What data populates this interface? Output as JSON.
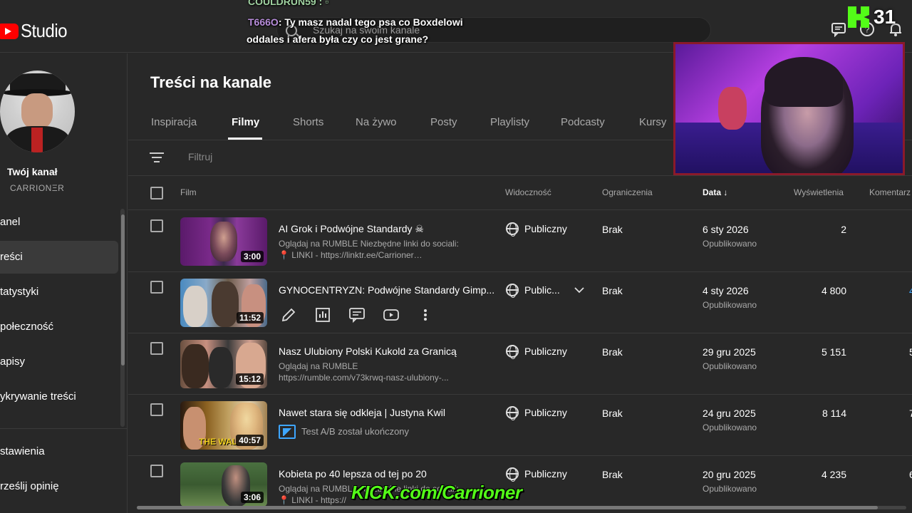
{
  "app": {
    "brand": "Studio"
  },
  "search": {
    "placeholder": "Szukaj na swoim kanale"
  },
  "chat": {
    "line1_user": "COULDRUN59 :",
    "line2_user": "T666O",
    "line2_text": ": Ty masz nadal tego psa co Boxdelowi",
    "line3_text": "oddales i afera była czy co jest grane?"
  },
  "kick": {
    "count": "31",
    "banner": "KICK.com/Carrioner"
  },
  "sidebar": {
    "channel_label": "Twój kanał",
    "channel_name": "CARRIOΝΞR",
    "items": [
      {
        "label": "anel"
      },
      {
        "label": "reści"
      },
      {
        "label": "tatystyki"
      },
      {
        "label": "połeczność"
      },
      {
        "label": "apisy"
      },
      {
        "label": "ykrywanie treści"
      },
      {
        "label": "stawienia"
      },
      {
        "label": "rześlij opinię"
      }
    ]
  },
  "main": {
    "title": "Treści na kanale",
    "tabs": [
      "Inspiracja",
      "Filmy",
      "Shorts",
      "Na żywo",
      "Posty",
      "Playlisty",
      "Podcasty",
      "Kursy"
    ],
    "active_tab": "Filmy",
    "filter_placeholder": "Filtruj"
  },
  "table": {
    "headers": {
      "film": "Film",
      "visibility": "Widoczność",
      "restrictions": "Ograniczenia",
      "date": "Data",
      "views": "Wyświetlenia",
      "comments": "Komentarz"
    },
    "rows": [
      {
        "title": "AI Grok i Podwójne Standardy ☠",
        "desc1": "Oglądaj na RUMBLE Niezbędne linki do sociali:",
        "desc2": "📍 LINKI - https://linktr.ee/Carrioner…",
        "duration": "3:00",
        "visibility": "Publiczny",
        "restrictions": "Brak",
        "date": "6 sty 2026",
        "status": "Opublikowano",
        "views": "2",
        "comments": ""
      },
      {
        "title": "GYNOCENTRYZN: Podwójne Standardy Gimp...",
        "desc1": "",
        "desc2": "",
        "duration": "11:52",
        "visibility": "Public...",
        "restrictions": "Brak",
        "date": "4 sty 2026",
        "status": "Opublikowano",
        "views": "4 800",
        "comments": "4"
      },
      {
        "title": "Nasz Ulubiony Polski Kukold za Granicą",
        "desc1": "Oglądaj na RUMBLE",
        "desc2": "https://rumble.com/v73krwq-nasz-ulubiony-...",
        "duration": "15:12",
        "visibility": "Publiczny",
        "restrictions": "Brak",
        "date": "29 gru 2025",
        "status": "Opublikowano",
        "views": "5 151",
        "comments": "5"
      },
      {
        "title": "Nawet stara się odkleja | Justyna Kwil",
        "desc1": "Test A/B został ukończony",
        "desc2": "",
        "duration": "40:57",
        "visibility": "Publiczny",
        "restrictions": "Brak",
        "date": "24 gru 2025",
        "status": "Opublikowano",
        "views": "8 114",
        "comments": "7"
      },
      {
        "title": "Kobieta po 40 lepsza od tej po 20",
        "desc1": "Oglądaj na RUMBLE Niezbędne linki do sociali:",
        "desc2": "📍 LINKI - https://",
        "duration": "3:06",
        "visibility": "Publiczny",
        "restrictions": "Brak",
        "date": "20 gru 2025",
        "status": "Opublikowano",
        "views": "4 235",
        "comments": "6"
      }
    ]
  },
  "colors": {
    "accent_red": "#ff0000",
    "kick_green": "#53fc18",
    "link_blue": "#3ea6ff"
  },
  "icons": [
    "search-icon",
    "feedback-icon",
    "help-icon",
    "bell-icon",
    "filter-icon",
    "globe-icon",
    "edit-icon",
    "analytics-icon",
    "comments-icon",
    "youtube-icon",
    "more-icon",
    "sort-arrow-icon",
    "dropdown-icon",
    "ab-test-icon"
  ]
}
